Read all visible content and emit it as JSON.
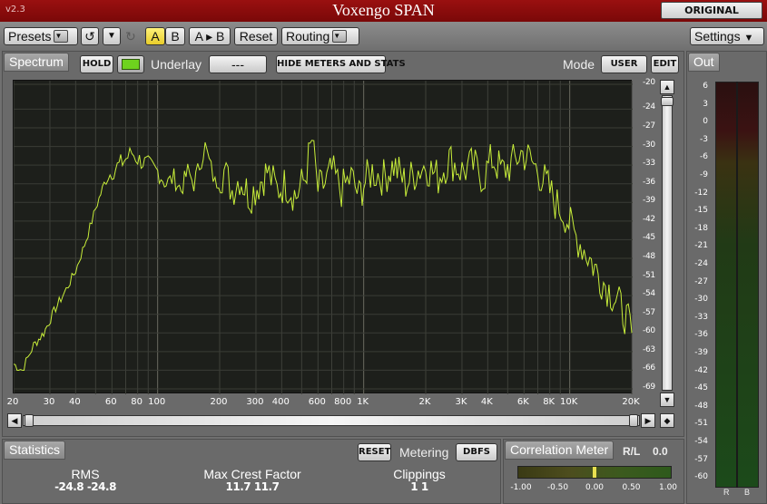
{
  "title_bar": {
    "version": "v2.3",
    "title": "Voxengo SPAN",
    "original_button": "ORIGINAL"
  },
  "toolbar": {
    "presets": "Presets",
    "ab_a": "A",
    "ab_b": "B",
    "a_to_b": "A ▸ B",
    "reset": "Reset",
    "routing": "Routing",
    "settings": "Settings"
  },
  "spectrum": {
    "tab": "Spectrum",
    "hold": "HOLD",
    "underlay_label": "Underlay",
    "underlay_value": "---",
    "hide_meters": "HIDE METERS AND STATS",
    "mode_label": "Mode",
    "mode_value": "USER",
    "edit": "EDIT"
  },
  "db_scale": [
    "-20",
    "-24",
    "-27",
    "-30",
    "-33",
    "-36",
    "-39",
    "-42",
    "-45",
    "-48",
    "-51",
    "-54",
    "-57",
    "-60",
    "-63",
    "-66",
    "-69"
  ],
  "freq_labels": [
    "20",
    "30",
    "40",
    "60",
    "80",
    "100",
    "200",
    "300",
    "400",
    "600",
    "800",
    "1K",
    "2K",
    "3K",
    "4K",
    "6K",
    "8K",
    "10K",
    "20K"
  ],
  "freq_values": [
    20,
    30,
    40,
    60,
    80,
    100,
    200,
    300,
    400,
    600,
    800,
    1000,
    2000,
    3000,
    4000,
    6000,
    8000,
    10000,
    20000
  ],
  "statistics": {
    "tab": "Statistics",
    "reset": "RESET",
    "metering_label": "Metering",
    "metering_value": "DBFS",
    "rms_label": "RMS",
    "rms_value": "-24.8  -24.8",
    "crest_label": "Max Crest Factor",
    "crest_value": "11.7   11.7",
    "clip_label": "Clippings",
    "clip_value": "1       1"
  },
  "correlation": {
    "tab": "Correlation Meter",
    "rl_label": "R/L",
    "rl_value": "0.0",
    "scale": [
      "-1.00",
      "-0.50",
      "0.00",
      "0.50",
      "1.00"
    ],
    "value": 0.0
  },
  "out_meter": {
    "tab": "Out",
    "scale": [
      "6",
      "3",
      "0",
      "-3",
      "-6",
      "-9",
      "-12",
      "-15",
      "-18",
      "-21",
      "-24",
      "-27",
      "-30",
      "-33",
      "-36",
      "-39",
      "-42",
      "-45",
      "-48",
      "-51",
      "-54",
      "-57",
      "-60"
    ],
    "channels": [
      "R",
      "B"
    ]
  },
  "chart_data": {
    "type": "line",
    "xscale": "log",
    "xlim": [
      20,
      20000
    ],
    "ylim": [
      -69,
      -20
    ],
    "x": [
      20,
      22,
      25,
      28,
      32,
      36,
      40,
      45,
      50,
      55,
      60,
      65,
      70,
      75,
      80,
      90,
      100,
      110,
      120,
      130,
      140,
      150,
      170,
      190,
      210,
      230,
      250,
      280,
      310,
      340,
      380,
      420,
      470,
      520,
      560,
      600,
      650,
      700,
      780,
      870,
      950,
      1000,
      1100,
      1250,
      1400,
      1600,
      1800,
      2000,
      2300,
      2600,
      3000,
      3400,
      3800,
      4200,
      4700,
      5200,
      5800,
      6400,
      7000,
      7700,
      8500,
      9500,
      10500,
      11500,
      12500,
      14000,
      15500,
      17000,
      18500,
      20000
    ],
    "values": [
      -65,
      -66,
      -62,
      -60,
      -56,
      -53,
      -50,
      -45,
      -40,
      -36,
      -34,
      -33,
      -32,
      -31,
      -32,
      -33,
      -34,
      -36,
      -35,
      -37,
      -34,
      -36,
      -30,
      -36,
      -34,
      -37,
      -35,
      -38,
      -36,
      -34,
      -37,
      -36,
      -38,
      -35,
      -29,
      -37,
      -36,
      -34,
      -37,
      -35,
      -38,
      -36,
      -34,
      -35,
      -33,
      -36,
      -34,
      -33,
      -35,
      -32,
      -34,
      -33,
      -35,
      -32,
      -34,
      -33,
      -31,
      -32,
      -34,
      -36,
      -39,
      -41,
      -44,
      -46,
      -48,
      -51,
      -53,
      -55,
      -57,
      -60
    ]
  }
}
